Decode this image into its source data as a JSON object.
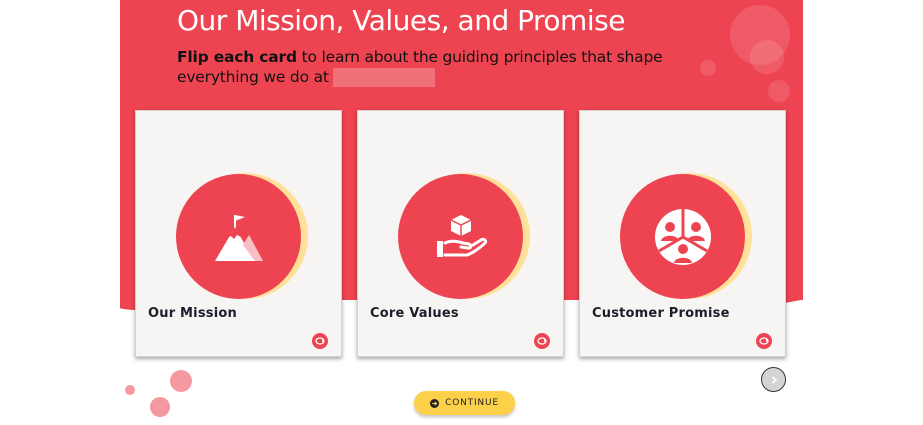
{
  "header": {
    "title": "Our Mission, Values, and Promise",
    "subtitle_bold": "Flip each card",
    "subtitle_rest": " to learn about the guiding principles that shape everything we do at"
  },
  "cards": [
    {
      "label": "Our Mission",
      "icon": "mountain-flag-icon"
    },
    {
      "label": "Core Values",
      "icon": "hand-box-icon"
    },
    {
      "label": "Customer Promise",
      "icon": "people-pie-icon"
    }
  ],
  "continue_label": "CONTINUE",
  "colors": {
    "brand_red": "#ee4452",
    "accent_yellow": "#fdd04a",
    "circle_shadow": "#ffe199",
    "card_bg": "#f7f5f3"
  }
}
